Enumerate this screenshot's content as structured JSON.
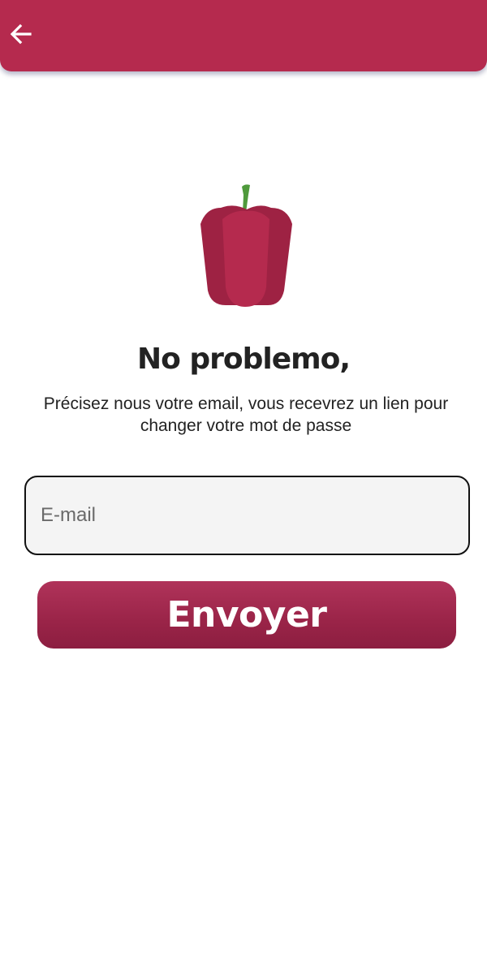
{
  "header": {
    "back_icon": "arrow-left-icon",
    "background_color": "#b52a4e"
  },
  "logo": {
    "icon": "bell-pepper-icon",
    "body_color": "#b52a4e",
    "shade_color": "#9e2243",
    "stem_color": "#4f9a3c"
  },
  "main": {
    "heading": "No problemo,",
    "subtitle": "Précisez nous votre email, vous recevrez un lien pour changer votre mot de passe"
  },
  "form": {
    "email_placeholder": "E-mail",
    "email_value": "",
    "submit_label": "Envoyer"
  }
}
